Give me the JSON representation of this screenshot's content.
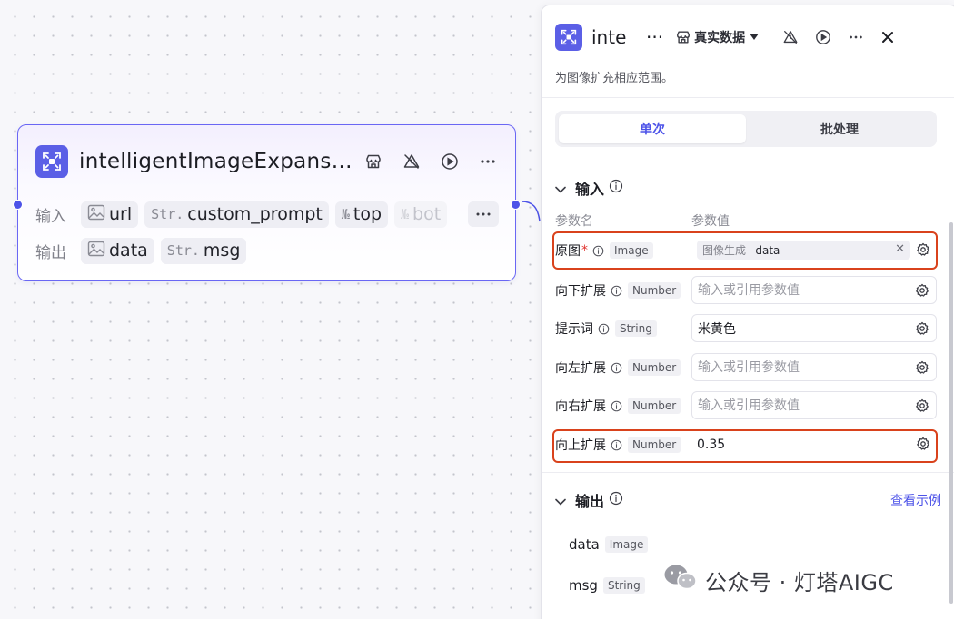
{
  "node": {
    "title": "intelligentImageExpans…",
    "input_label": "输入",
    "output_label": "输出",
    "inputs": [
      {
        "type": "img",
        "name": "url"
      },
      {
        "type": "Str.",
        "name": "custom_prompt"
      },
      {
        "type": "№",
        "name": "top"
      },
      {
        "type": "№",
        "name": "bot"
      }
    ],
    "outputs": [
      {
        "type": "img",
        "name": "data"
      },
      {
        "type": "Str.",
        "name": "msg"
      }
    ],
    "more_label": "···"
  },
  "panel": {
    "title": "inte",
    "title_ellipsis": "···",
    "data_mode": "真实数据",
    "description": "为图像扩充相应范围。",
    "tabs": [
      "单次",
      "批处理"
    ],
    "active_tab": "单次",
    "input_section": {
      "title": "输入",
      "col_name": "参数名",
      "col_value": "参数值",
      "params": [
        {
          "label": "原图",
          "required": true,
          "type": "Image",
          "value_ref_source": "图像生成",
          "value_ref_sep": " - ",
          "value_ref_field": "data",
          "placeholder": "",
          "value": ""
        },
        {
          "label": "向下扩展",
          "required": false,
          "type": "Number",
          "placeholder": "输入或引用参数值",
          "value": ""
        },
        {
          "label": "提示词",
          "required": false,
          "type": "String",
          "placeholder": "输入或引用参数值",
          "value": "米黄色"
        },
        {
          "label": "向左扩展",
          "required": false,
          "type": "Number",
          "placeholder": "输入或引用参数值",
          "value": ""
        },
        {
          "label": "向右扩展",
          "required": false,
          "type": "Number",
          "placeholder": "输入或引用参数值",
          "value": ""
        },
        {
          "label": "向上扩展",
          "required": false,
          "type": "Number",
          "placeholder": "输入或引用参数值",
          "value": "0.35"
        }
      ]
    },
    "output_section": {
      "title": "输出",
      "example_link": "查看示例",
      "outputs": [
        {
          "name": "data",
          "type": "Image"
        },
        {
          "name": "msg",
          "type": "String"
        }
      ]
    }
  },
  "watermark": {
    "text": "公众号 · 灯塔AIGC"
  },
  "colors": {
    "accent": "#4d53e8",
    "node_border": "#6a67f4",
    "highlight": "#d9421c",
    "required": "#e0312c"
  }
}
